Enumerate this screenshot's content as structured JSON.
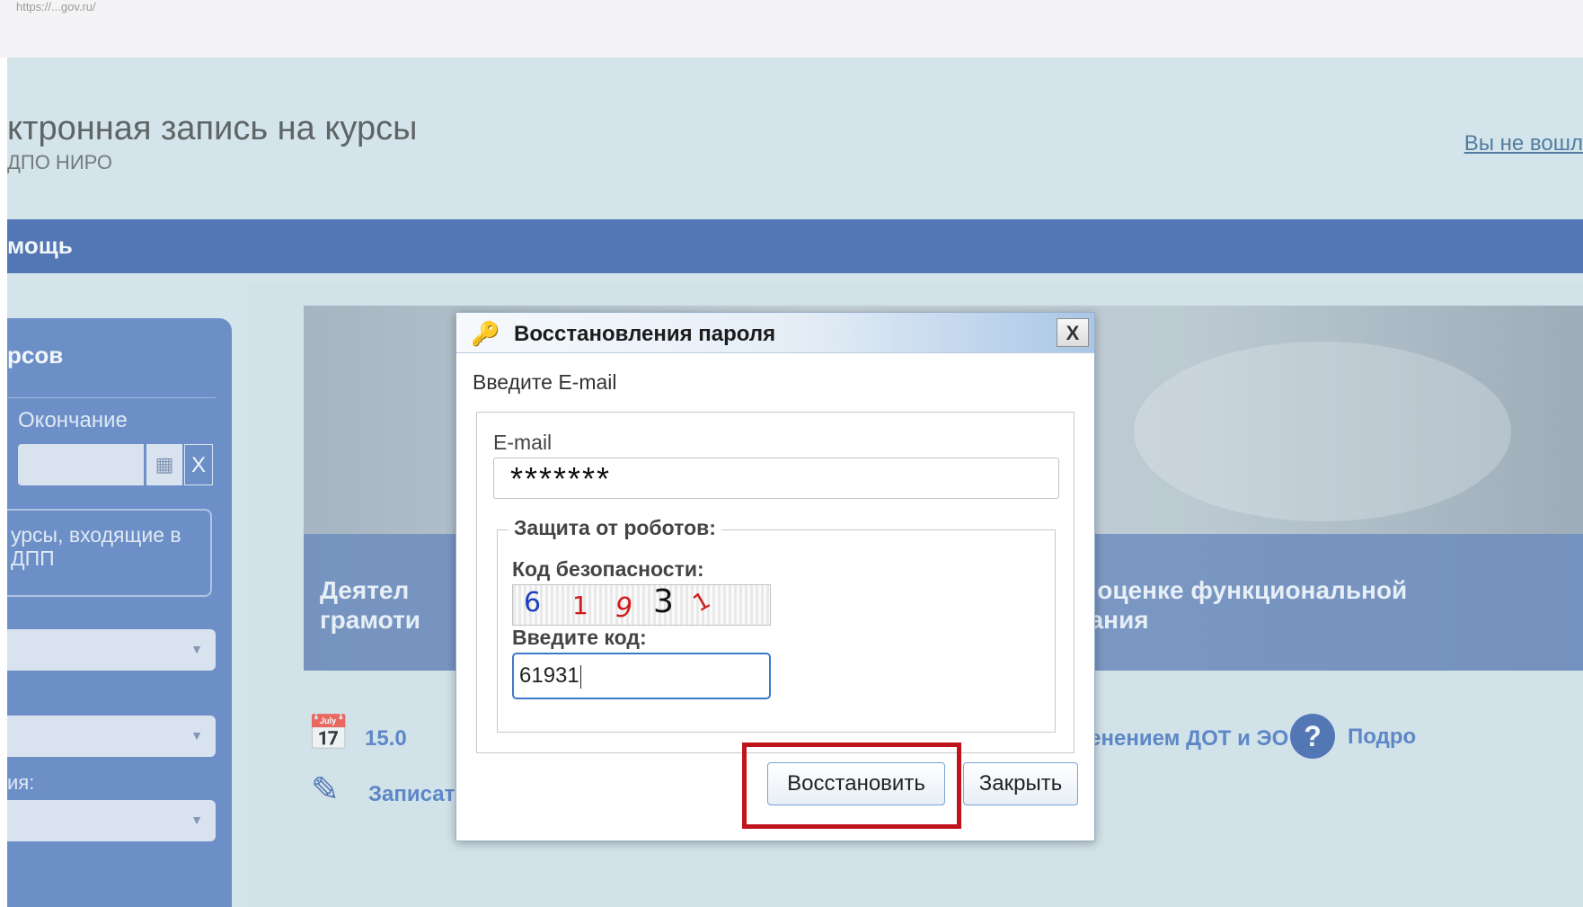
{
  "browser": {
    "url": "https://...gov.ru/"
  },
  "page": {
    "header_title": "ктронная запись на курсы",
    "header_subtitle": "ДПО НИРО",
    "login_link": "Вы не вошл",
    "navbar_item": "мощь"
  },
  "sidebar": {
    "title": "рсов",
    "end_label": "Окончание",
    "clear_label": "X",
    "checkbox_text": "урсы, входящие в ДПП",
    "small_label": "ия:"
  },
  "banner": {
    "left_text": "Деятел\nграмоти",
    "right_text": "ванию и оценке функциональной\nобразования"
  },
  "course": {
    "date": "15.0",
    "mode": "ма с применением ДОТ и ЭО",
    "help_symbol": "?",
    "help_text": "Подро",
    "enroll": "Записаться"
  },
  "dialog": {
    "title": "Восстановления пароля",
    "close_symbol": "X",
    "prompt": "Введите E-mail",
    "email_label": "E-mail",
    "email_value": "*******",
    "robot_legend": "Защита от роботов:",
    "code_label": "Код безопасности:",
    "captcha_chars": [
      "6",
      "1",
      "9",
      "3",
      "1"
    ],
    "enter_code_label": "Введите код:",
    "code_value": "61931",
    "restore_button": "Восстановить",
    "close_button": "Закрыть"
  },
  "colors": {
    "navbar": "#2d55a6",
    "sidebar": "#4f76bf",
    "highlight_border": "#c0141c",
    "input_focus": "#3d78c9"
  },
  "icons": {
    "key": "key-icon",
    "calendar": "calendar-icon",
    "help": "help-icon",
    "edit": "edit-icon"
  }
}
